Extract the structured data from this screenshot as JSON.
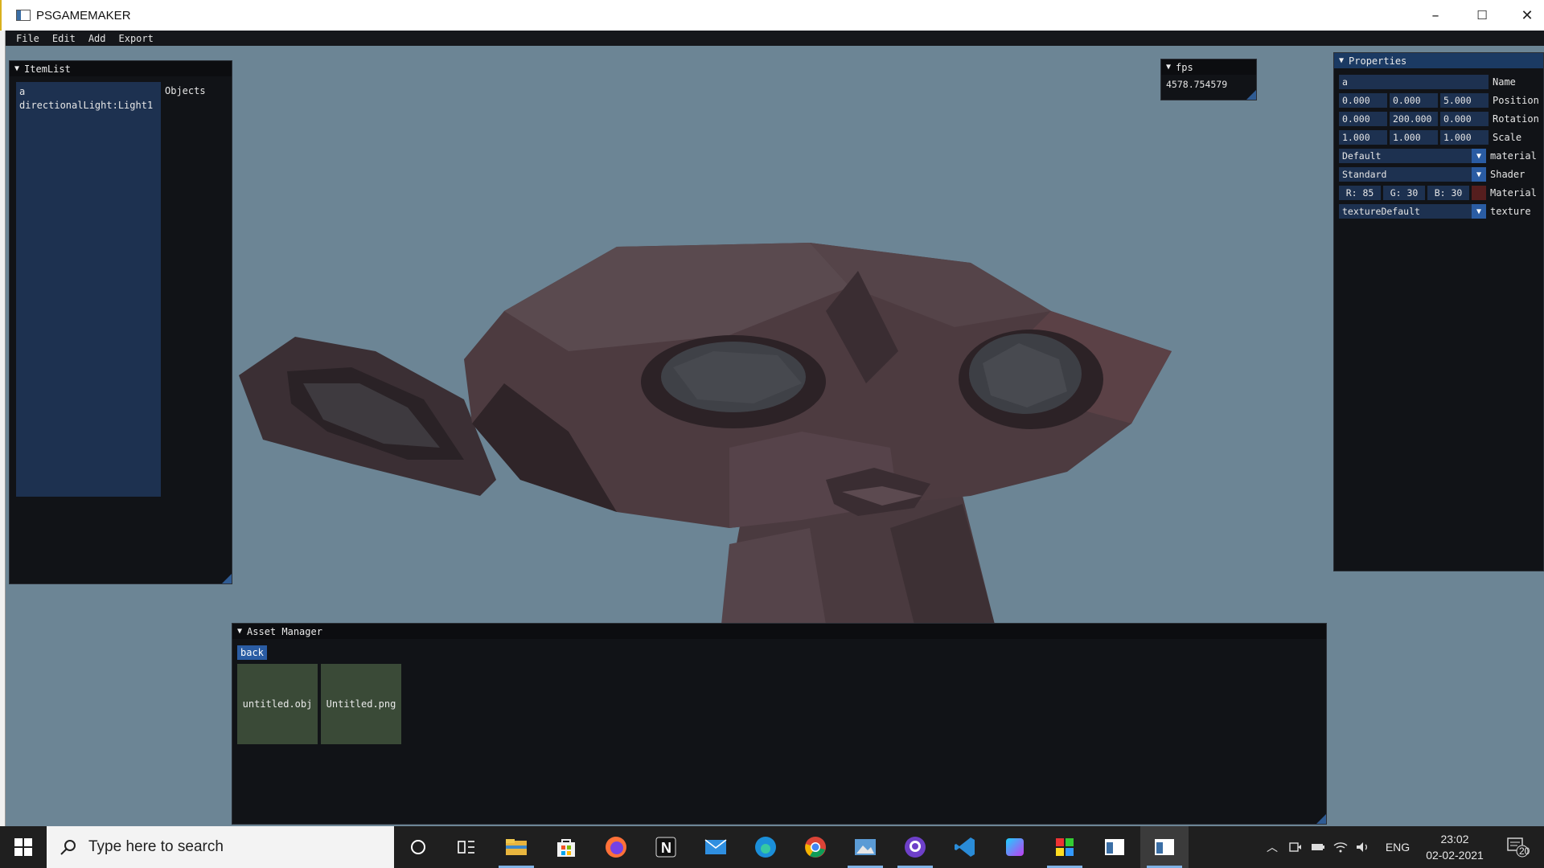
{
  "window": {
    "title": "PSGAMEMAKER",
    "minimize": "–",
    "maximize": "☐",
    "close": "✕"
  },
  "menu": [
    "File",
    "Edit",
    "Add",
    "Export"
  ],
  "item_list": {
    "title": "ItemList",
    "items": [
      "a",
      "directionalLight:Light1"
    ],
    "objects_label": "Objects"
  },
  "fps": {
    "title": "fps",
    "value": "4578.754579"
  },
  "properties": {
    "title": "Properties",
    "name": {
      "value": "a",
      "label": "Name"
    },
    "position": {
      "x": "0.000",
      "y": "0.000",
      "z": "5.000",
      "label": "Position"
    },
    "rotation": {
      "x": "0.000",
      "y": "200.000",
      "z": "0.000",
      "label": "Rotation"
    },
    "scale": {
      "x": "1.000",
      "y": "1.000",
      "z": "1.000",
      "label": "Scale"
    },
    "material_select": {
      "value": "Default",
      "label": "material"
    },
    "shader_select": {
      "value": "Standard",
      "label": "Shader"
    },
    "material_color": {
      "r": "R: 85",
      "g": "G: 30",
      "b": "B: 30",
      "label": "Material",
      "swatch": "#551e1e"
    },
    "texture_select": {
      "value": "textureDefault",
      "label": "texture"
    }
  },
  "asset_manager": {
    "title": "Asset Manager",
    "back_label": "back",
    "assets": [
      "untitled.obj",
      "Untitled.png"
    ]
  },
  "taskbar": {
    "search_placeholder": "Type here to search",
    "language": "ENG",
    "time": "23:02",
    "date": "02-02-2021",
    "notifications": "20"
  },
  "colors": {
    "viewport_bg": "#6c8595",
    "panel_bg": "#111317",
    "selection_bg": "#1d3150",
    "accent": "#2a5ca3",
    "asset_tile": "#3a4a37",
    "model": "#4d3b40"
  }
}
